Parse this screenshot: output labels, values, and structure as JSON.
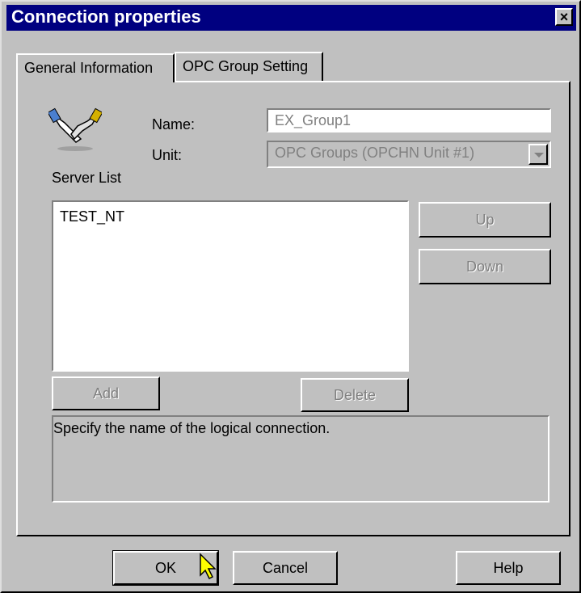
{
  "window": {
    "title": "Connection properties",
    "close_glyph": "×"
  },
  "tabs": [
    {
      "label": "General Information",
      "active": true
    },
    {
      "label": "OPC Group Setting",
      "active": false
    }
  ],
  "form": {
    "name_label": "Name:",
    "name_value": "EX_Group1",
    "unit_label": "Unit:",
    "unit_value": "OPC Groups (OPCHN Unit #1)",
    "icon": "handshake-icon"
  },
  "server_list": {
    "label": "Server List",
    "items": [
      "TEST_NT"
    ]
  },
  "buttons": {
    "up": "Up",
    "down": "Down",
    "add": "Add",
    "delete": "Delete",
    "ok": "OK",
    "cancel": "Cancel",
    "help": "Help"
  },
  "description": "Specify the name of the logical connection."
}
